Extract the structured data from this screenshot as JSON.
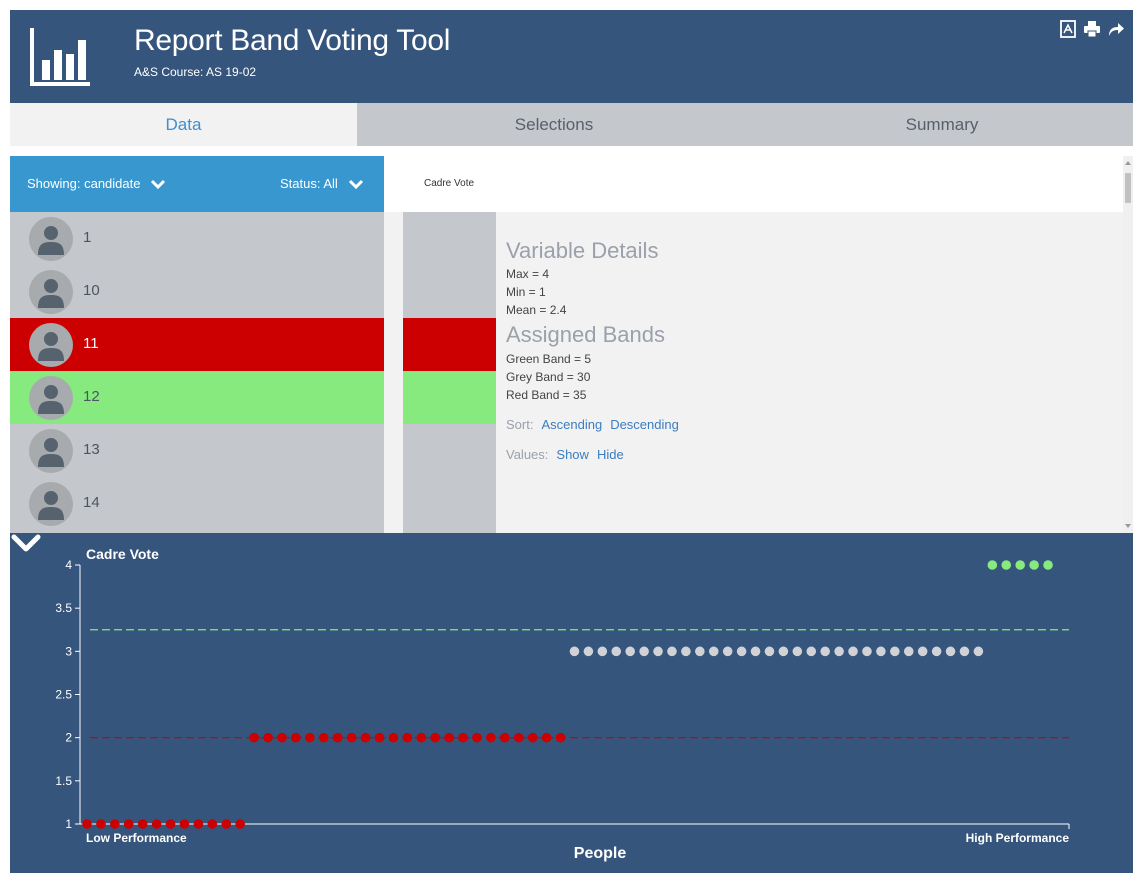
{
  "app": {
    "title": "Report Band Voting Tool",
    "subtitle": "A&S Course: AS 19-02",
    "logo_icon": "bar-chart-icon",
    "header_actions": [
      {
        "name": "pdf-icon"
      },
      {
        "name": "print-icon"
      },
      {
        "name": "share-icon"
      }
    ]
  },
  "tabs": [
    {
      "label": "Data",
      "active": true
    },
    {
      "label": "Selections",
      "active": false
    },
    {
      "label": "Summary",
      "active": false
    }
  ],
  "filters": {
    "showing_label": "Showing: candidate",
    "status_label": "Status: All"
  },
  "candidates": [
    {
      "label": "1",
      "status": "grey"
    },
    {
      "label": "10",
      "status": "grey"
    },
    {
      "label": "11",
      "status": "red"
    },
    {
      "label": "12",
      "status": "green"
    },
    {
      "label": "13",
      "status": "grey"
    },
    {
      "label": "14",
      "status": "grey"
    }
  ],
  "colors": {
    "red": "#cc0000",
    "green": "#86ea7e",
    "grey": "#c4c7cb",
    "header": "#35557c",
    "accent": "#3997cf"
  },
  "column": {
    "label": "Cadre Vote"
  },
  "details": {
    "variable_heading": "Variable Details",
    "max": "Max = 4",
    "min": "Min = 1",
    "mean": "Mean = 2.4",
    "bands_heading": "Assigned Bands",
    "green_band": "Green Band = 5",
    "grey_band": "Grey Band = 30",
    "red_band": "Red Band = 35",
    "sort_label": "Sort:",
    "sort_asc": "Ascending",
    "sort_desc": "Descending",
    "values_label": "Values:",
    "values_show": "Show",
    "values_hide": "Hide"
  },
  "chart_data": {
    "type": "scatter",
    "title": "Cadre Vote",
    "xlabel": "People",
    "x_tick_left": "Low Performance",
    "x_tick_right": "High Performance",
    "ylim": [
      1,
      4
    ],
    "yticks": [
      "1",
      "1.5",
      "2",
      "2.5",
      "3",
      "3.5",
      "4"
    ],
    "thresholds": [
      {
        "value": 3.25,
        "color": "#86ea7e"
      },
      {
        "value": 2,
        "color": "#cc0000"
      }
    ],
    "series": [
      {
        "color": "#cc0000",
        "value": 1,
        "count": 12
      },
      {
        "color": "#cc0000",
        "value": 2,
        "count": 23
      },
      {
        "color": "#d0d2d5",
        "value": 3,
        "count": 30
      },
      {
        "color": "#86ea7e",
        "value": 4,
        "count": 5
      }
    ]
  }
}
